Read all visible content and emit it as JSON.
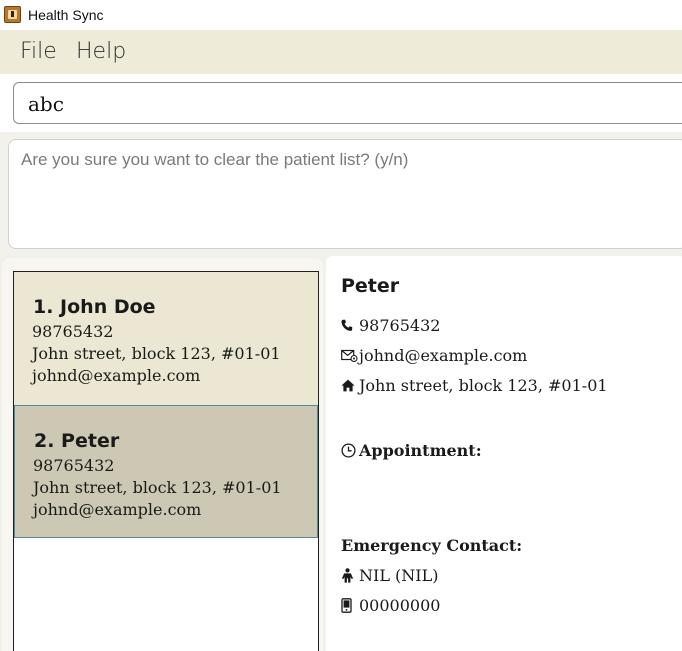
{
  "window": {
    "title": "Health Sync",
    "icon": "app-icon"
  },
  "menu": {
    "file": "File",
    "help": "Help"
  },
  "command": {
    "value": "abc"
  },
  "result": {
    "text": "Are you sure you want to clear the patient list? (y/n)"
  },
  "patients": [
    {
      "name": "1. John Doe",
      "phone": "98765432",
      "address": "John street, block 123, #01-01",
      "email": "johnd@example.com"
    },
    {
      "name": "2. Peter",
      "phone": "98765432",
      "address": "John street, block 123, #01-01",
      "email": "johnd@example.com"
    }
  ],
  "detail": {
    "name": "Peter",
    "phone": "98765432",
    "email": "johnd@example.com",
    "address": "John street, block 123, #01-01",
    "appointment_label": "Appointment:",
    "emergency_label": "Emergency Contact:",
    "emergency_name": "NIL (NIL)",
    "emergency_phone": "00000000",
    "icons": [
      "phone-icon",
      "email-icon",
      "home-icon",
      "clock-icon",
      "person-icon",
      "mobile-icon"
    ]
  },
  "colors": {
    "menubar": "#efebd9",
    "card": "#ebe7d2",
    "card_selected": "#ccc8b3",
    "selected_border": "#4f8c98"
  }
}
